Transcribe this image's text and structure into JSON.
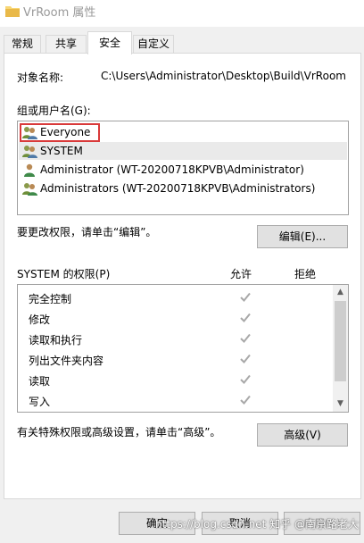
{
  "window": {
    "title": "VrRoom 属性"
  },
  "tabs": [
    {
      "label": "常规",
      "active": false
    },
    {
      "label": "共享",
      "active": false
    },
    {
      "label": "安全",
      "active": true
    },
    {
      "label": "自定义",
      "active": false
    }
  ],
  "object": {
    "label": "对象名称:",
    "value": "C:\\Users\\Administrator\\Desktop\\Build\\VrRoom"
  },
  "groups": {
    "label": "组或用户名(G):",
    "items": [
      {
        "name": "Everyone",
        "icon": "group-users-icon",
        "highlighted": true
      },
      {
        "name": "SYSTEM",
        "icon": "group-users-icon",
        "selected": true
      },
      {
        "name": "Administrator (WT-20200718KPVB\\Administrator)",
        "icon": "user-icon"
      },
      {
        "name": "Administrators (WT-20200718KPVB\\Administrators)",
        "icon": "group-users-icon"
      }
    ]
  },
  "edit": {
    "hint": "要更改权限，请单击“编辑”。",
    "button": "编辑(E)..."
  },
  "permissions": {
    "title": "SYSTEM 的权限(P)",
    "allow_header": "允许",
    "deny_header": "拒绝",
    "rows": [
      {
        "name": "完全控制",
        "allow": true,
        "deny": false
      },
      {
        "name": "修改",
        "allow": true,
        "deny": false
      },
      {
        "name": "读取和执行",
        "allow": true,
        "deny": false
      },
      {
        "name": "列出文件夹内容",
        "allow": true,
        "deny": false
      },
      {
        "name": "读取",
        "allow": true,
        "deny": false
      },
      {
        "name": "写入",
        "allow": true,
        "deny": false
      }
    ]
  },
  "advanced": {
    "hint": "有关特殊权限或高级设置，请单击“高级”。",
    "button": "高级(V)"
  },
  "footer": {
    "ok": "确定",
    "cancel": "取消",
    "apply": "应用(A)"
  },
  "watermark": "https://blog.csdn.net  知乎 @南京路老大",
  "colors": {
    "highlight_border": "#d93a3a",
    "check": "#a8a8a8"
  }
}
